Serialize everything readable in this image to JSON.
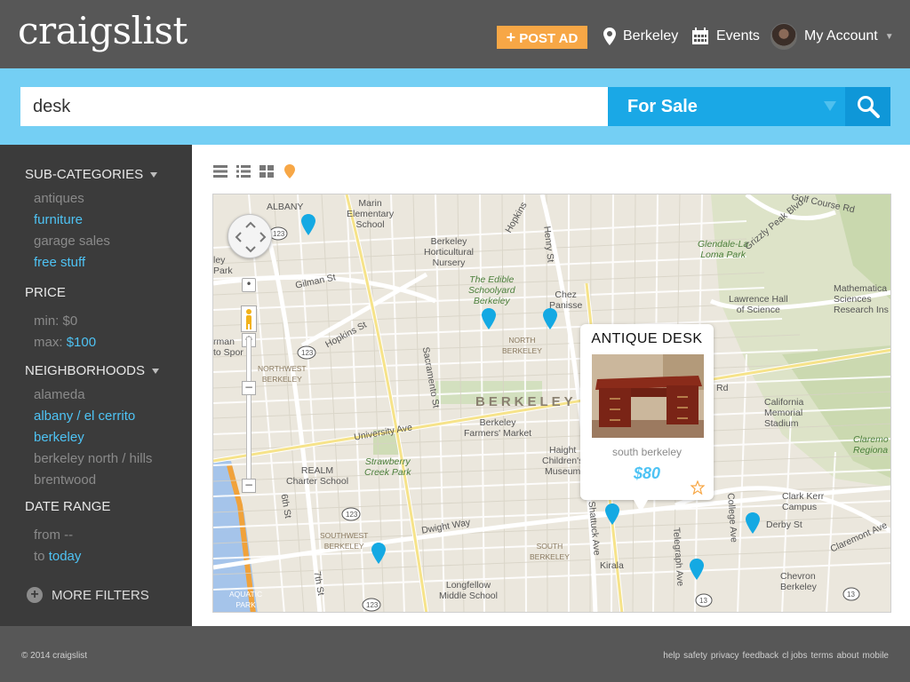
{
  "header": {
    "logo": "craigslist",
    "post_ad": "POST AD",
    "location": "Berkeley",
    "events": "Events",
    "account": "My Account"
  },
  "search": {
    "query": "desk",
    "category": "For Sale"
  },
  "sidebar": {
    "subcategories_heading": "SUB-CATEGORIES",
    "subcategories": [
      {
        "label": "antiques",
        "active": false
      },
      {
        "label": "furniture",
        "active": true
      },
      {
        "label": "garage sales",
        "active": false
      },
      {
        "label": "free stuff",
        "active": true
      }
    ],
    "price_heading": "PRICE",
    "price_min_label": "min:",
    "price_min_value": "$0",
    "price_max_label": "max:",
    "price_max_value": "$100",
    "neighborhoods_heading": "NEIGHBORHOODS",
    "neighborhoods": [
      {
        "label": "alameda",
        "active": false
      },
      {
        "label": "albany / el cerrito",
        "active": true
      },
      {
        "label": "berkeley",
        "active": true
      },
      {
        "label": "berkeley north / hills",
        "active": false
      },
      {
        "label": "brentwood",
        "active": false
      }
    ],
    "date_heading": "DATE RANGE",
    "date_from_label": "from",
    "date_from_value": "--",
    "date_to_label": "to",
    "date_to_value": "today",
    "more_filters": "MORE FILTERS"
  },
  "map": {
    "labels": {
      "albany": "ALBANY",
      "marin_school": "Marin\nElementary\nSchool",
      "hort_nursery": "Berkeley\nHorticultural\nNursery",
      "edible_schoolyard": "The Edible\nSchoolyard\nBerkeley",
      "chez_panisse": "Chez\nPanisse",
      "glendale": "Glendale-La\nLoma Park",
      "lawrence_hall": "Lawrence Hall\nof Science",
      "math_sciences": "Mathematica\nSciences\nResearch Ins",
      "gilman": "Gilman St",
      "hopkins": "Hopkins St",
      "sacramento": "Sacramento St",
      "university": "University Ave",
      "berkeley_big": "BERKELEY",
      "farmers_market": "Berkeley\nFarmers' Market",
      "haight": "Haight\nChildren's\nMuseum",
      "california_memorial": "California\nMemorial\nStadium",
      "claremont": "Claremo\nRegiona",
      "realm": "REALM\nCharter School",
      "strawberry": "Strawberry\nCreek Park",
      "dwight": "Dwight Way",
      "clark_kerr": "Clark Kerr\nCampus",
      "derby": "Derby St",
      "kirala": "Kirala",
      "longfellow": "Longfellow\nMiddle School",
      "chevron": "Chevron\nBerkeley",
      "aquatic": "AQUATIC\nPARK",
      "north_berkeley": "NORTH\nBERKELEY",
      "northwest_berkeley": "NORTHWEST\nBERKELEY",
      "southwest_berkeley": "SOUTHWEST\nBERKELEY",
      "south_berkeley": "SOUTH\nBERKELEY",
      "sixth": "6th St",
      "seventh": "7th St",
      "henry": "Henry St",
      "shattuck": "Shattuck Ave",
      "telegraph": "Telegraph Ave",
      "college": "College Ave",
      "claremont_ave": "Claremont Ave",
      "grizzly": "Grizzly Peak Blvd",
      "hopkins_ne": "Hopkins",
      "panoramic": "Centennial Dr",
      "course": "Golf Course Rd",
      "arman": "rman\nto Spor",
      "ley_park": "ley\nPark",
      "route_123a": "123",
      "route_123b": "123",
      "route_123c": "123",
      "route_123d": "123",
      "route_13a": "13",
      "route_13b": "13",
      "rd": "Rd"
    },
    "popup": {
      "title": "ANTIQUE DESK",
      "location": "south berkeley",
      "price": "$80"
    }
  },
  "footer": {
    "copyright": "© 2014 craigslist",
    "links": [
      "help",
      "safety",
      "privacy",
      "feedback",
      "cl jobs",
      "terms",
      "about",
      "mobile"
    ]
  },
  "colors": {
    "header_bg": "#575757",
    "accent_orange": "#f7a746",
    "search_band": "#74cff4",
    "select_blue": "#1aa8e6",
    "link_blue": "#4ec3f4",
    "sidebar_bg": "#3b3b3b"
  }
}
